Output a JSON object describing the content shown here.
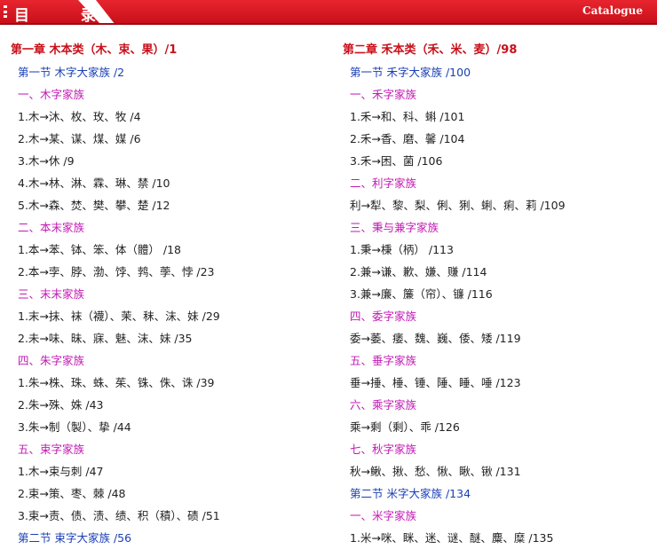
{
  "header": {
    "title": "目  录",
    "catalogue_label": "Catalogue",
    "accent": "#c8101a"
  },
  "left": [
    {
      "type": "chapter",
      "text": "第一章 木本类（木、束、果）/1"
    },
    {
      "type": "section",
      "text": "第一节 木字大家族 /2"
    },
    {
      "type": "family",
      "text": "一、木字家族"
    },
    {
      "type": "item",
      "text": "1.木→沐、枚、玫、牧 /4"
    },
    {
      "type": "item",
      "text": "2.木→某、谋、煤、媒 /6"
    },
    {
      "type": "item",
      "text": "3.木→休 /9"
    },
    {
      "type": "item",
      "text": "4.木→林、淋、霖、琳、禁 /10"
    },
    {
      "type": "item",
      "text": "5.木→森、焚、樊、攀、楚 /12"
    },
    {
      "type": "family",
      "text": "二、本末家族"
    },
    {
      "type": "item",
      "text": "1.本→苯、钵、笨、体（體） /18"
    },
    {
      "type": "item",
      "text": "2.本→孛、脖、渤、饽、鹁、荸、悖 /23"
    },
    {
      "type": "family",
      "text": "三、末末家族"
    },
    {
      "type": "item",
      "text": "1.末→抹、袜（襪）、茉、秣、沫、妹 /29"
    },
    {
      "type": "item",
      "text": "2.未→味、昧、寐、魅、沫、妹 /35"
    },
    {
      "type": "family",
      "text": "四、朱字家族"
    },
    {
      "type": "item",
      "text": "1.朱→株、珠、蛛、茱、铢、侏、诛 /39"
    },
    {
      "type": "item",
      "text": "2.朱→殊、姝 /43"
    },
    {
      "type": "item",
      "text": "3.朱→制（製）、挚 /44"
    },
    {
      "type": "family",
      "text": "五、束字家族"
    },
    {
      "type": "item",
      "text": "1.木→束与刺 /47"
    },
    {
      "type": "item",
      "text": "2.束→策、枣、棘 /48"
    },
    {
      "type": "item",
      "text": "3.束→责、债、渍、绩、积（積）、碛 /51"
    },
    {
      "type": "section",
      "text": "第二节 束字大家族 /56"
    }
  ],
  "right": [
    {
      "type": "chapter",
      "text": "第二章 禾本类（禾、米、麦）/98"
    },
    {
      "type": "section",
      "text": "第一节 禾字大家族 /100"
    },
    {
      "type": "family",
      "text": "一、禾字家族"
    },
    {
      "type": "item",
      "text": "1.禾→和、科、蝌 /101"
    },
    {
      "type": "item",
      "text": "2.禾→香、磨、馨 /104"
    },
    {
      "type": "item",
      "text": "3.禾→困、菌 /106"
    },
    {
      "type": "family",
      "text": "二、利字家族"
    },
    {
      "type": "item",
      "text": "利→犁、黎、梨、俐、猁、蜊、痢、莉 /109"
    },
    {
      "type": "family",
      "text": "三、秉与兼字家族"
    },
    {
      "type": "item",
      "text": "1.秉→棅（柄） /113"
    },
    {
      "type": "item",
      "text": "2.兼→谦、歉、嫌、赚 /114"
    },
    {
      "type": "item",
      "text": "3.兼→廉、簾（帘）、镰 /116"
    },
    {
      "type": "family",
      "text": "四、委字家族"
    },
    {
      "type": "item",
      "text": "委→萎、痿、魏、巍、倭、矮 /119"
    },
    {
      "type": "family",
      "text": "五、垂字家族"
    },
    {
      "type": "item",
      "text": "垂→捶、棰、锤、陲、睡、唾 /123"
    },
    {
      "type": "family",
      "text": "六、乘字家族"
    },
    {
      "type": "item",
      "text": "乘→剩（剩）、乖 /126"
    },
    {
      "type": "family",
      "text": "七、秋字家族"
    },
    {
      "type": "item",
      "text": "秋→鳅、揪、愁、愀、瞅、锹 /131"
    },
    {
      "type": "section",
      "text": "第二节 米字大家族 /134"
    },
    {
      "type": "family",
      "text": "一、米字家族"
    },
    {
      "type": "item",
      "text": "1.米→咪、眯、迷、谜、醚、麋、糜 /135"
    }
  ]
}
